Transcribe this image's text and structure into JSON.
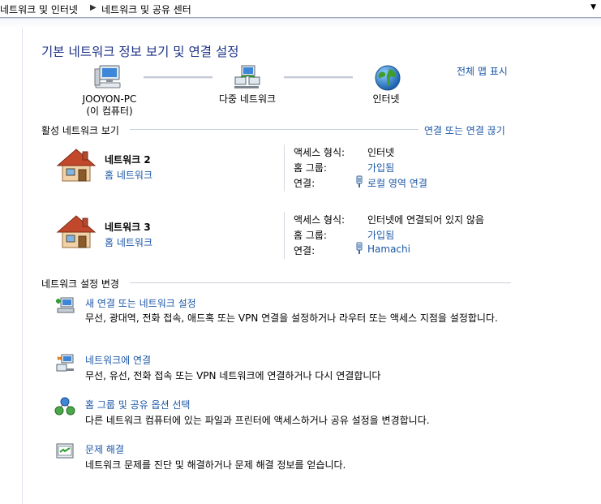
{
  "address_bar": {
    "crumbs": [
      "네트워크 및 인터넷",
      "네트워크 및 공유 센터"
    ]
  },
  "page_title": "기본 네트워크 정보 보기 및 연결 설정",
  "full_map_link": "전체 맵 표시",
  "map": {
    "computer": {
      "name": "JOOYON-PC",
      "sub": "(이 컴퓨터)"
    },
    "network": {
      "name": "다중 네트워크"
    },
    "internet": {
      "name": "인터넷"
    }
  },
  "active_networks": {
    "header": "활성 네트워크 보기",
    "connect_link": "연결 또는 연결 끊기",
    "labels": {
      "access": "액세스 형식:",
      "homegroup": "홈 그룹:",
      "connections": "연결:"
    },
    "items": [
      {
        "name": "네트워크  2",
        "type": "홈 네트워크",
        "access": "인터넷",
        "homegroup": "가입됨",
        "connection": "로컬 영역 연결"
      },
      {
        "name": "네트워크  3",
        "type": "홈 네트워크",
        "access": "인터넷에 연결되어 있지 않음",
        "homegroup": "가입됨",
        "connection": "Hamachi"
      }
    ]
  },
  "settings": {
    "header": "네트워크 설정 변경",
    "tasks": [
      {
        "title": "새 연결 또는 네트워크 설정",
        "desc": "무선, 광대역, 전화 접속, 애드혹 또는 VPN 연결을 설정하거나 라우터 또는 액세스 지점을 설정합니다."
      },
      {
        "title": "네트워크에 연결",
        "desc": "무선, 유선, 전화 접속 또는 VPN 네트워크에 연결하거나 다시 연결합니다"
      },
      {
        "title": "홈 그룹 및 공유 옵션 선택",
        "desc": "다른 네트워크 컴퓨터에 있는 파일과 프린터에 액세스하거나 공유 설정을 변경합니다."
      },
      {
        "title": "문제 해결",
        "desc": "네트워크 문제를 진단 및 해결하거나 문제 해결 정보를 얻습니다."
      }
    ]
  },
  "colors": {
    "link": "#1c57a6",
    "title": "#1e3287"
  }
}
